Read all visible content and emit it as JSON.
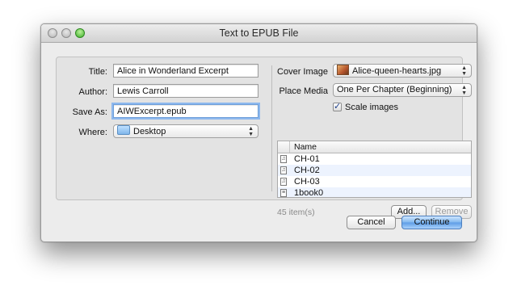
{
  "window": {
    "title": "Text to EPUB File"
  },
  "form": {
    "title_label": "Title:",
    "title_value": "Alice in Wonderland Excerpt",
    "author_label": "Author:",
    "author_value": "Lewis Carroll",
    "save_as_label": "Save As:",
    "save_as_value": "AIWExcerpt.epub",
    "where_label": "Where:",
    "where_value": "Desktop"
  },
  "options": {
    "cover_image_label": "Cover Image",
    "cover_image_value": "Alice-queen-hearts.jpg",
    "place_media_label": "Place Media",
    "place_media_value": "One Per Chapter (Beginning)",
    "scale_images_label": "Scale images",
    "scale_images_checked": true
  },
  "file_list": {
    "column_name": "Name",
    "items": [
      {
        "name": "CH-01",
        "icon": "text-file-icon"
      },
      {
        "name": "CH-02",
        "icon": "text-file-icon"
      },
      {
        "name": "CH-03",
        "icon": "text-file-icon"
      },
      {
        "name": "1book0",
        "icon": "text-file-icon"
      }
    ],
    "count_text": "45 item(s)"
  },
  "buttons": {
    "add": "Add...",
    "remove": "Remove",
    "cancel": "Cancel",
    "continue": "Continue"
  }
}
